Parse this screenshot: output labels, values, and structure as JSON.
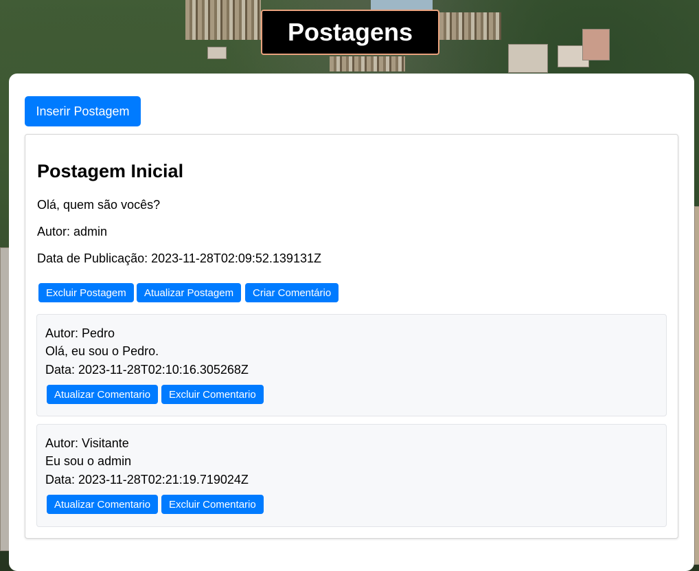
{
  "page": {
    "title": "Postagens"
  },
  "toolbar": {
    "insert_label": "Inserir Postagem"
  },
  "post": {
    "title": "Postagem Inicial",
    "content": "Olá, quem são vocês?",
    "author_line": "Autor: admin",
    "date_line": "Data de Publicação: 2023-11-28T02:09:52.139131Z",
    "actions": {
      "delete_label": "Excluir Postagem",
      "update_label": "Atualizar Postagem",
      "comment_label": "Criar Comentário"
    }
  },
  "comments": [
    {
      "author_line": "Autor: Pedro",
      "text": "Olá, eu sou o Pedro.",
      "date_line": "Data: 2023-11-28T02:10:16.305268Z",
      "update_label": "Atualizar Comentario",
      "delete_label": "Excluir Comentario"
    },
    {
      "author_line": "Autor: Visitante",
      "text": "Eu sou o admin",
      "date_line": "Data: 2023-11-28T02:21:19.719024Z",
      "update_label": "Atualizar Comentario",
      "delete_label": "Excluir Comentario"
    }
  ],
  "colors": {
    "primary": "#007bff",
    "title_bg": "#000000",
    "title_border": "#e9a27e",
    "comment_bg": "#f7f8fa"
  }
}
